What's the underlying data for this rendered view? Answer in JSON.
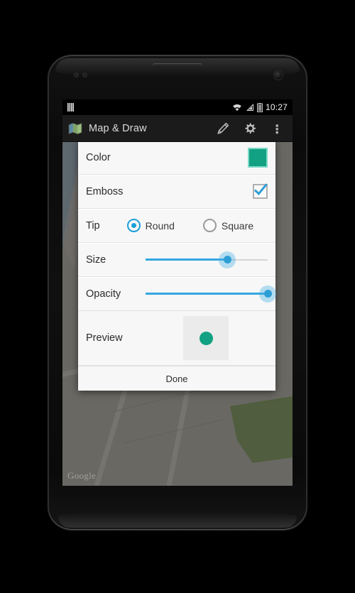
{
  "status_bar": {
    "time": "10:27",
    "icons": [
      "sim-card-icon",
      "wifi-icon",
      "cellular-signal-icon",
      "battery-icon"
    ]
  },
  "action_bar": {
    "app_icon": "map-app-icon",
    "title": "Map & Draw",
    "actions": [
      {
        "name": "draw-pencil-button",
        "icon": "pencil-icon"
      },
      {
        "name": "settings-button",
        "icon": "gear-icon"
      },
      {
        "name": "overflow-menu-button",
        "icon": "three-dots-icon"
      }
    ]
  },
  "map": {
    "watermark": "Google"
  },
  "dialog": {
    "rows": {
      "color": {
        "label": "Color",
        "value_hex": "#12a182"
      },
      "emboss": {
        "label": "Emboss",
        "checked": true,
        "check_hex": "#2e9fd6"
      },
      "tip": {
        "label": "Tip",
        "options": [
          {
            "label": "Round",
            "selected": true
          },
          {
            "label": "Square",
            "selected": false
          }
        ]
      },
      "size": {
        "label": "Size",
        "percent": 67,
        "accent_hex": "#34a8e0"
      },
      "opacity": {
        "label": "Opacity",
        "percent": 100,
        "accent_hex": "#34a8e0"
      },
      "preview": {
        "label": "Preview",
        "dot_hex": "#12a182",
        "swatch_hex": "#ebebeb"
      }
    },
    "done_label": "Done"
  },
  "nav_bar": {
    "buttons": [
      {
        "name": "nav-back-button",
        "icon": "back-arrow-icon"
      },
      {
        "name": "nav-home-button",
        "icon": "home-icon"
      },
      {
        "name": "nav-recents-button",
        "icon": "recents-icon"
      }
    ]
  }
}
